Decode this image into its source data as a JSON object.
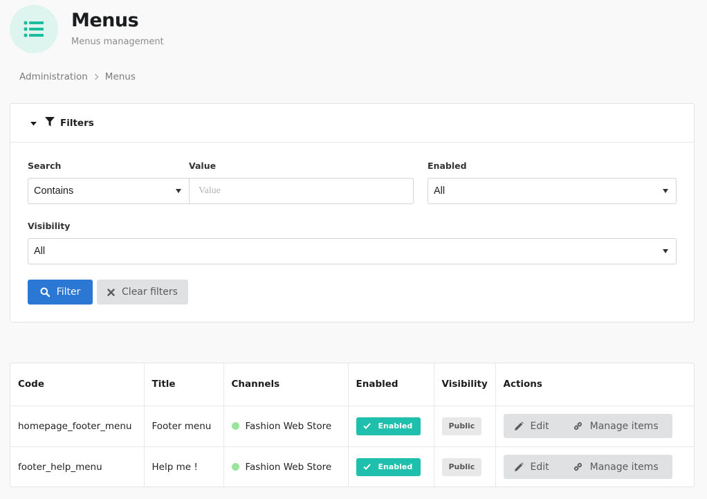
{
  "header": {
    "title": "Menus",
    "subtitle": "Menus management",
    "icon": "list-icon",
    "accent_color": "#1abc9c"
  },
  "breadcrumb": {
    "items": [
      "Administration",
      "Menus"
    ]
  },
  "filters": {
    "title": "Filters",
    "search_label": "Search",
    "search_mode": "Contains",
    "value_label": "Value",
    "value_placeholder": "Value",
    "value": "",
    "enabled_label": "Enabled",
    "enabled_value": "All",
    "visibility_label": "Visibility",
    "visibility_value": "All",
    "filter_button": "Filter",
    "clear_button": "Clear filters",
    "primary_color": "#2b77d4"
  },
  "table": {
    "columns": [
      "Code",
      "Title",
      "Channels",
      "Enabled",
      "Visibility",
      "Actions"
    ],
    "rows": [
      {
        "code": "homepage_footer_menu",
        "title": "Footer menu",
        "channel": "Fashion Web Store",
        "enabled": "Enabled",
        "visibility": "Public",
        "edit": "Edit",
        "manage": "Manage items"
      },
      {
        "code": "footer_help_menu",
        "title": "Help me !",
        "channel": "Fashion Web Store",
        "enabled": "Enabled",
        "visibility": "Public",
        "edit": "Edit",
        "manage": "Manage items"
      }
    ],
    "enabled_color": "#1fbfae",
    "channel_dot_color": "#9be49b"
  }
}
